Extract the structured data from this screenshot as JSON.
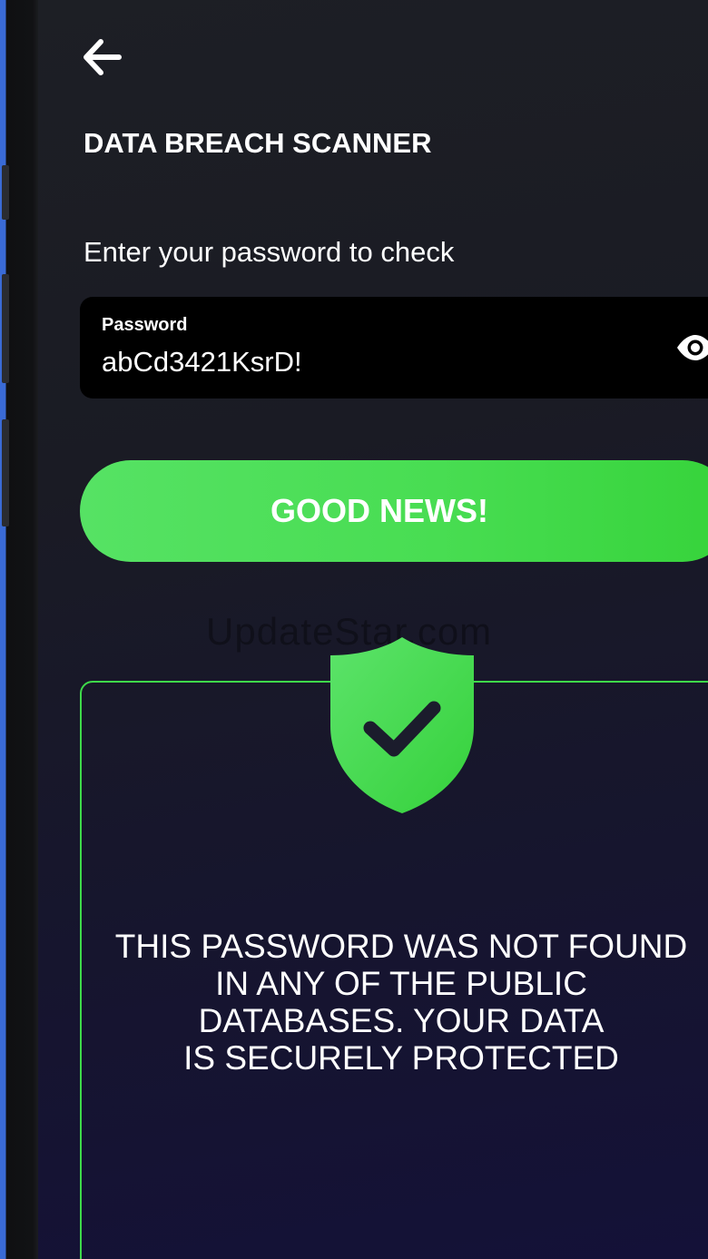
{
  "header": {
    "back_icon": "arrow-left-icon",
    "title": "DATA BREACH SCANNER"
  },
  "form": {
    "prompt": "Enter your password to check",
    "password_label": "Password",
    "password_value": "abCd3421KsrD!",
    "visibility_icon": "eye-icon"
  },
  "result": {
    "status_label": "GOOD NEWS!",
    "icon": "shield-check-icon",
    "message_lines": [
      "THIS PASSWORD WAS NOT FOUND",
      "IN ANY OF THE PUBLIC",
      "DATABASES. YOUR DATA",
      "IS SECURELY PROTECTED"
    ]
  },
  "watermark": "UpdateStar.com",
  "colors": {
    "accent_green": "#48dd52",
    "field_bg": "#000000",
    "dark_navy": "#1a1b2e"
  }
}
